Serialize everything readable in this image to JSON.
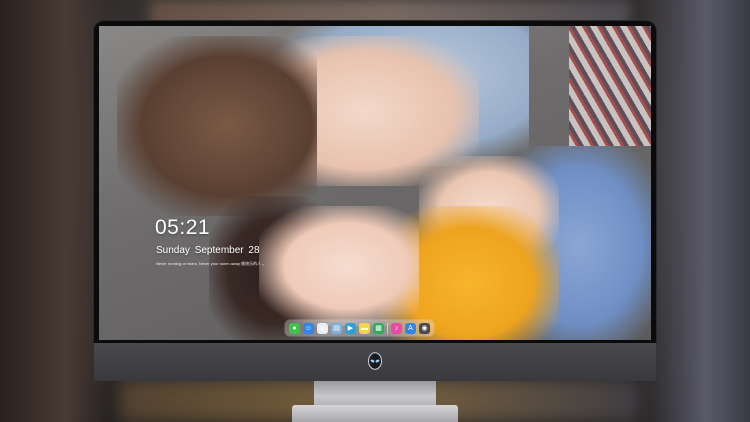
{
  "lock_screen": {
    "time": "05:21",
    "date": "Sunday September  28",
    "motto": "Never running on tears, Never your storm away 做快乐的人 。"
  },
  "dock": {
    "apps": [
      {
        "name": "messages-app-icon",
        "glyph": "●",
        "color": "#3cc44a"
      },
      {
        "name": "finder-app-icon",
        "glyph": "☺",
        "color": "#2f86e8"
      },
      {
        "name": "safari-app-icon",
        "glyph": "◎",
        "color": "#e8eef6"
      },
      {
        "name": "preview-app-icon",
        "glyph": "▤",
        "color": "#7fb0e0"
      },
      {
        "name": "final-cut-app-icon",
        "glyph": "▶",
        "color": "#2aa0d8"
      },
      {
        "name": "notes-app-icon",
        "glyph": "▬",
        "color": "#f5d44a"
      },
      {
        "name": "numbers-app-icon",
        "glyph": "▦",
        "color": "#2fae5a"
      },
      {
        "name": "itunes-app-icon",
        "glyph": "♪",
        "color": "#e84aa8"
      },
      {
        "name": "app-store-icon",
        "glyph": "A",
        "color": "#2f86e8"
      },
      {
        "name": "camera-app-icon",
        "glyph": "◉",
        "color": "#4a4a4e"
      }
    ],
    "accent": "#ffffff"
  },
  "monitor": {
    "logo_icon": "alienware-logo-icon"
  }
}
